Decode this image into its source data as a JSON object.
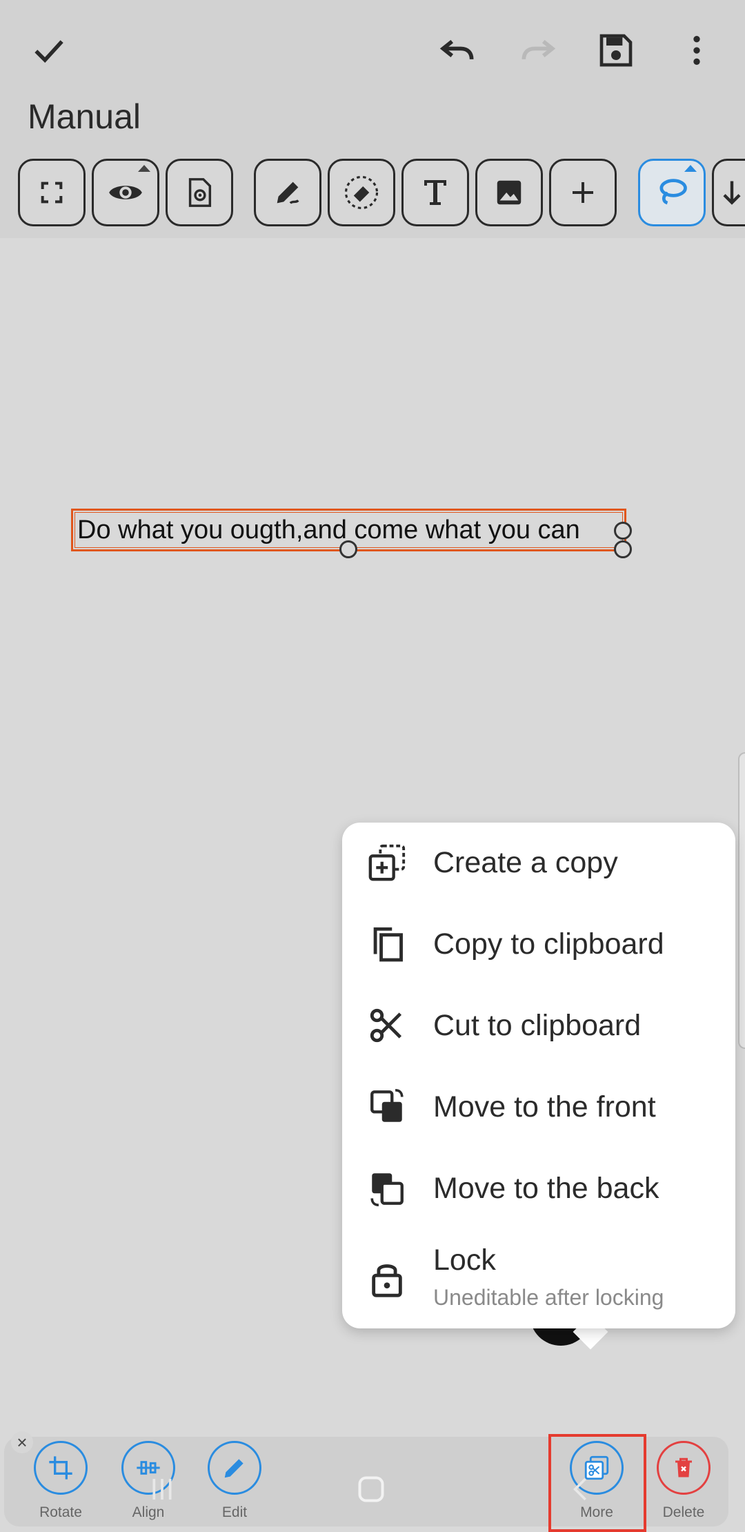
{
  "document": {
    "title": "Manual"
  },
  "top_actions": {
    "confirm_icon": "check-icon",
    "undo_icon": "undo-icon",
    "redo_icon": "redo-icon",
    "save_icon": "save-icon",
    "overflow_icon": "more-vert-icon"
  },
  "toolbar": {
    "tools": [
      "fullscreen",
      "view",
      "page-settings",
      "pen",
      "eraser",
      "text",
      "image",
      "add",
      "lasso",
      "scroll-down"
    ],
    "active_tool": "lasso"
  },
  "canvas": {
    "selected_text": "Do what you ougth,and come what you can"
  },
  "context_menu": {
    "items": [
      {
        "label": "Create a copy",
        "icon": "create-copy-icon"
      },
      {
        "label": "Copy to clipboard",
        "icon": "copy-icon"
      },
      {
        "label": "Cut to clipboard",
        "icon": "scissors-icon"
      },
      {
        "label": "Move to the front",
        "icon": "bring-to-front-icon"
      },
      {
        "label": "Move to the back",
        "icon": "send-to-back-icon"
      },
      {
        "label": "Lock",
        "sublabel": "Uneditable after locking",
        "icon": "lock-icon"
      }
    ]
  },
  "selection_bar": {
    "rotate": "Rotate",
    "align": "Align",
    "edit": "Edit",
    "more": "More",
    "delete": "Delete"
  },
  "colors": {
    "accent": "#2a8ce0",
    "selection_border": "#e0571e",
    "delete": "#e34040",
    "highlight": "#e53b2f"
  }
}
